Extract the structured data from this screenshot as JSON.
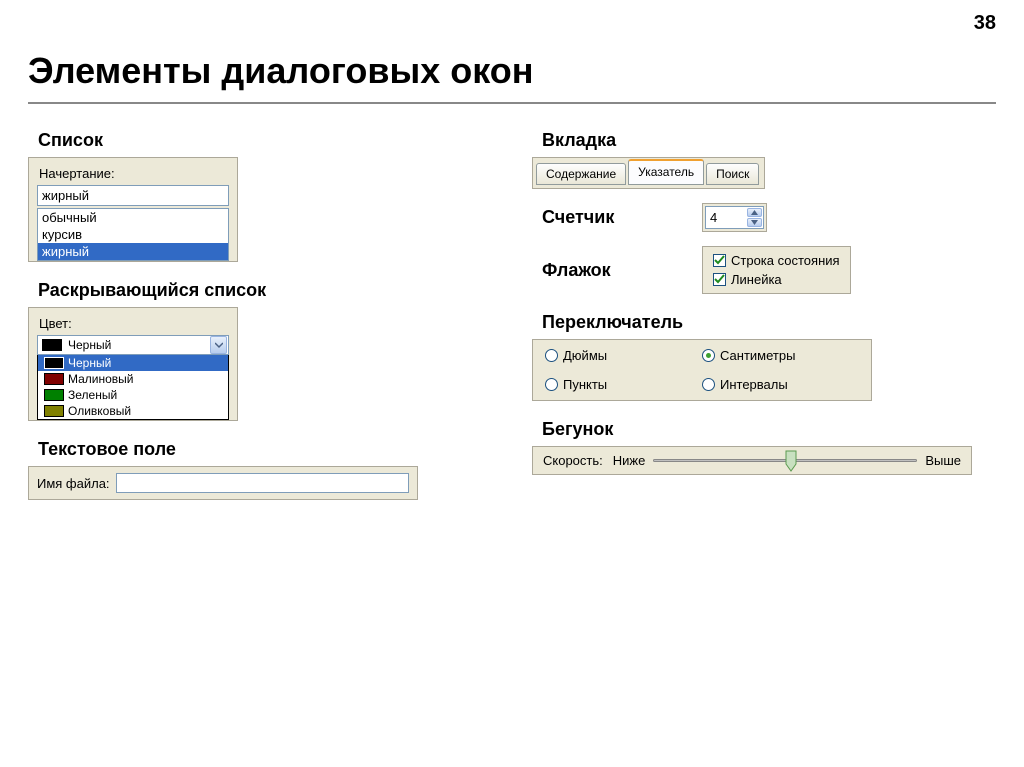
{
  "page_number": "38",
  "title": "Элементы диалоговых окон",
  "sections": {
    "list_label": "Список",
    "dropdown_label": "Раскрывающийся список",
    "textfield_label": "Текстовое поле",
    "tab_label": "Вкладка",
    "counter_label": "Счетчик",
    "checkbox_label": "Флажок",
    "radio_label": "Переключатель",
    "slider_label": "Бегунок"
  },
  "list": {
    "caption": "Начертание:",
    "value": "жирный",
    "items": [
      "обычный",
      "курсив",
      "жирный"
    ]
  },
  "dropdown": {
    "caption": "Цвет:",
    "value": "Черный",
    "items": [
      {
        "label": "Черный",
        "color": "#000000"
      },
      {
        "label": "Малиновый",
        "color": "#800000"
      },
      {
        "label": "Зеленый",
        "color": "#008000"
      },
      {
        "label": "Оливковый",
        "color": "#808000"
      }
    ]
  },
  "textfield": {
    "caption": "Имя файла:",
    "value": ""
  },
  "tabs": [
    "Содержание",
    "Указатель",
    "Поиск"
  ],
  "counter": {
    "value": "4"
  },
  "checkboxes": [
    "Строка состояния",
    "Линейка"
  ],
  "radios": [
    "Дюймы",
    "Сантиметры",
    "Пункты",
    "Интервалы"
  ],
  "slider": {
    "caption": "Скорость:",
    "low": "Ниже",
    "high": "Выше"
  }
}
